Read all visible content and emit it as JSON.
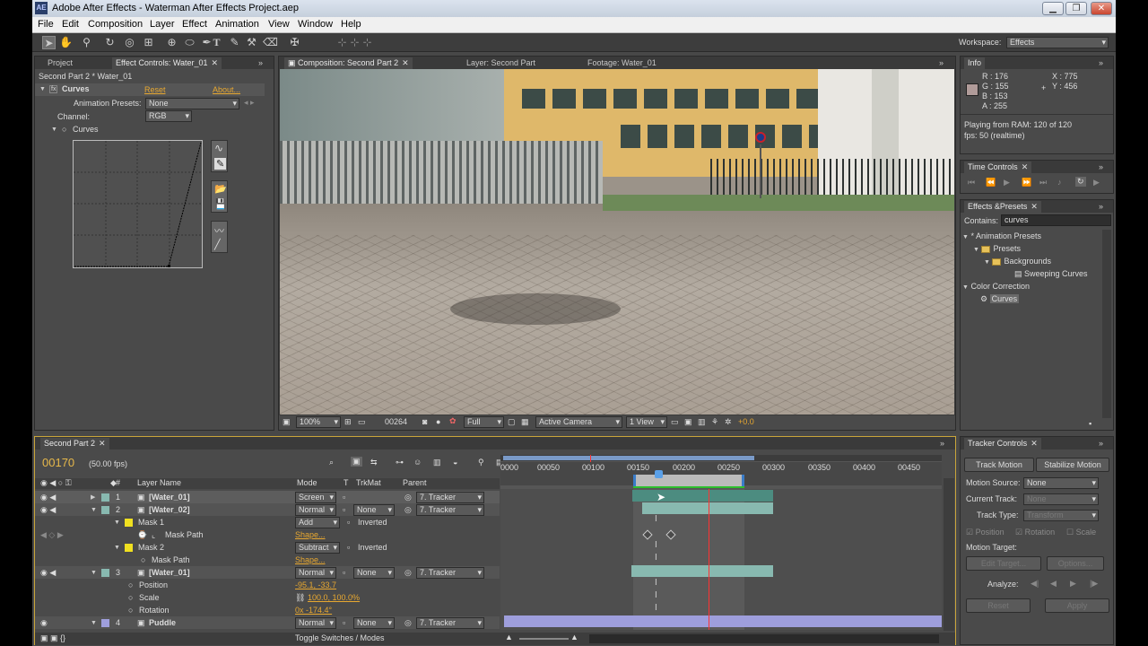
{
  "window": {
    "title": "Adobe After Effects - Waterman After Effects Project.aep",
    "app_icon": "AE"
  },
  "menu": [
    "File",
    "Edit",
    "Composition",
    "Layer",
    "Effect",
    "Animation",
    "View",
    "Window",
    "Help"
  ],
  "workspace": {
    "label": "Workspace:",
    "value": "Effects"
  },
  "left_panel": {
    "tabs": [
      "Project",
      "Effect Controls: Water_01"
    ],
    "context": "Second Part 2 * Water_01",
    "effect_name": "Curves",
    "reset": "Reset",
    "about": "About...",
    "presets_label": "Animation Presets:",
    "presets_value": "None",
    "channel_label": "Channel:",
    "channel_value": "RGB",
    "curves_label": "Curves"
  },
  "comp_panel": {
    "tabs": [
      "Composition: Second Part 2",
      "Layer: Second Part",
      "Footage: Water_01"
    ],
    "zoom": "100%",
    "timecode": "00264",
    "resolution": "Full",
    "camera": "Active Camera",
    "views": "1 View",
    "exposure": "+0.0"
  },
  "info": {
    "tab": "Info",
    "r": "R : 176",
    "g": "G : 155",
    "b": "B : 153",
    "a": "A : 255",
    "x": "X : 775",
    "y": "Y : 456",
    "status1": "Playing from RAM: 120 of 120",
    "status2": "fps: 50 (realtime)",
    "swatch_color": "#b09b99"
  },
  "time_controls": {
    "tab": "Time Controls"
  },
  "effects_presets": {
    "tab": "Effects &Presets",
    "contains_label": "Contains:",
    "contains_value": "curves",
    "tree": [
      "* Animation Presets",
      "Presets",
      "Backgrounds",
      "Sweeping Curves",
      "Color Correction",
      "Curves"
    ]
  },
  "timeline": {
    "tab": "Second Part 2",
    "timecode": "00170",
    "fps": "(50.00 fps)",
    "headers": {
      "num": "#",
      "layer": "Layer Name",
      "mode": "Mode",
      "t": "T",
      "trkmat": "TrkMat",
      "parent": "Parent"
    },
    "ruler": [
      "0000",
      "00050",
      "00100",
      "00150",
      "00200",
      "00250",
      "00300",
      "00350",
      "00400",
      "00450"
    ],
    "rows": [
      {
        "num": "1",
        "name": "[Water_01]",
        "mode": "Screen",
        "trkmat": "",
        "parent": "7. Tracker"
      },
      {
        "num": "2",
        "name": "[Water_02]",
        "mode": "Normal",
        "trkmat": "None",
        "parent": "7. Tracker"
      },
      {
        "name": "Mask 1",
        "mode": "Add",
        "inverted": "Inverted"
      },
      {
        "name": "Mask Path",
        "value": "Shape..."
      },
      {
        "name": "Mask 2",
        "mode": "Subtract",
        "inverted": "Inverted"
      },
      {
        "name": "Mask Path",
        "value": "Shape..."
      },
      {
        "num": "3",
        "name": "[Water_01]",
        "mode": "Normal",
        "trkmat": "None",
        "parent": "7. Tracker"
      },
      {
        "name": "Position",
        "value": "-95.1, -33.7"
      },
      {
        "name": "Scale",
        "value": "100.0, 100.0%"
      },
      {
        "name": "Rotation",
        "value": "0x -174.4°"
      },
      {
        "num": "4",
        "name": "Puddle",
        "mode": "Normal",
        "trkmat": "None",
        "parent": "7. Tracker"
      }
    ],
    "toggle": "Toggle Switches / Modes"
  },
  "tracker": {
    "tab": "Tracker Controls",
    "track_motion": "Track Motion",
    "stabilize_motion": "Stabilize Motion",
    "motion_source_label": "Motion Source:",
    "motion_source": "None",
    "current_track_label": "Current Track:",
    "current_track": "None",
    "track_type_label": "Track Type:",
    "track_type": "Transform",
    "position": "Position",
    "rotation": "Rotation",
    "scale": "Scale",
    "motion_target": "Motion Target:",
    "edit_target": "Edit Target...",
    "options": "Options...",
    "analyze": "Analyze:",
    "reset": "Reset",
    "apply": "Apply"
  },
  "colors": {
    "timecode": "#e6b84a",
    "track_bar": "#88b9b0",
    "puddle_bar": "#9e9edc",
    "selected_bar": "#4c8c80",
    "cti": "#ff3333"
  }
}
